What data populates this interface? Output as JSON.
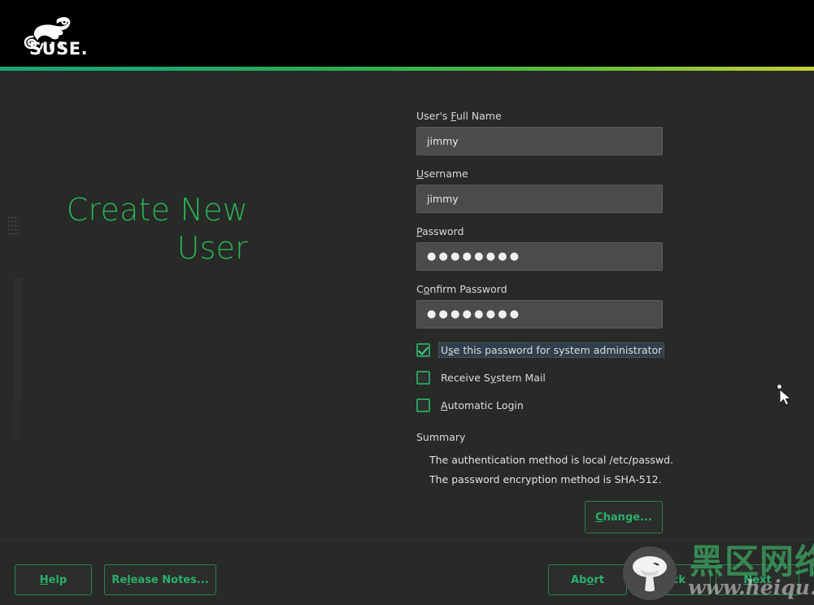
{
  "header": {
    "brand": "SUSE.",
    "logo_icon": "suse-chameleon-logo"
  },
  "page": {
    "title": "Create New User"
  },
  "form": {
    "fields": [
      {
        "label_pre": "User's ",
        "label_acc": "F",
        "label_post": "ull Name",
        "value": "jimmy",
        "placeholder": "",
        "type": "text",
        "name": "full-name"
      },
      {
        "label_pre": "",
        "label_acc": "U",
        "label_post": "sername",
        "value": "jimmy",
        "placeholder": "",
        "type": "text",
        "name": "username"
      },
      {
        "label_pre": "",
        "label_acc": "P",
        "label_post": "assword",
        "value": "●●●●●●●●",
        "placeholder": "",
        "type": "password",
        "name": "password"
      },
      {
        "label_pre": "C",
        "label_acc": "o",
        "label_post": "nfirm Password",
        "value": "●●●●●●●●",
        "placeholder": "",
        "type": "password",
        "name": "confirm-password"
      }
    ],
    "checkboxes": [
      {
        "label_pre": "U",
        "label_acc": "s",
        "label_post": "e this password for system administrator",
        "checked": true,
        "focused": true,
        "name": "use-password-for-admin"
      },
      {
        "label_pre": "Receive S",
        "label_acc": "y",
        "label_post": "stem Mail",
        "checked": false,
        "focused": false,
        "name": "receive-system-mail"
      },
      {
        "label_pre": "",
        "label_acc": "A",
        "label_post": "utomatic Login",
        "checked": false,
        "focused": false,
        "name": "automatic-login"
      }
    ]
  },
  "summary": {
    "title": "Summary",
    "lines": [
      "The authentication method is local /etc/passwd.",
      "The password encryption method is SHA-512."
    ],
    "change_pre": "",
    "change_acc": "C",
    "change_post": "hange..."
  },
  "bottom_bar": {
    "help": {
      "pre": "",
      "acc": "H",
      "post": "elp"
    },
    "release_notes": {
      "pre": "Re",
      "acc": "l",
      "post": "ease Notes..."
    },
    "abort": {
      "pre": "Ab",
      "acc": "o",
      "post": "rt"
    },
    "back": {
      "pre": "",
      "acc": "B",
      "post": "ack"
    },
    "next": {
      "pre": "",
      "acc": "N",
      "post": "ext"
    }
  },
  "watermark": {
    "chinese": "黑区网络",
    "url": "www.heiqu.com",
    "logo_icon": "mushroom-logo"
  },
  "colors": {
    "background": "#272a27",
    "header": "#000000",
    "accent_green": "#2caf55",
    "button_border": "#2f7f55",
    "button_text": "#2caf6b",
    "input_bg": "#4a4c4a",
    "checkbox_border": "#2a9d5e",
    "focus_highlight": "#2f3f4d"
  }
}
